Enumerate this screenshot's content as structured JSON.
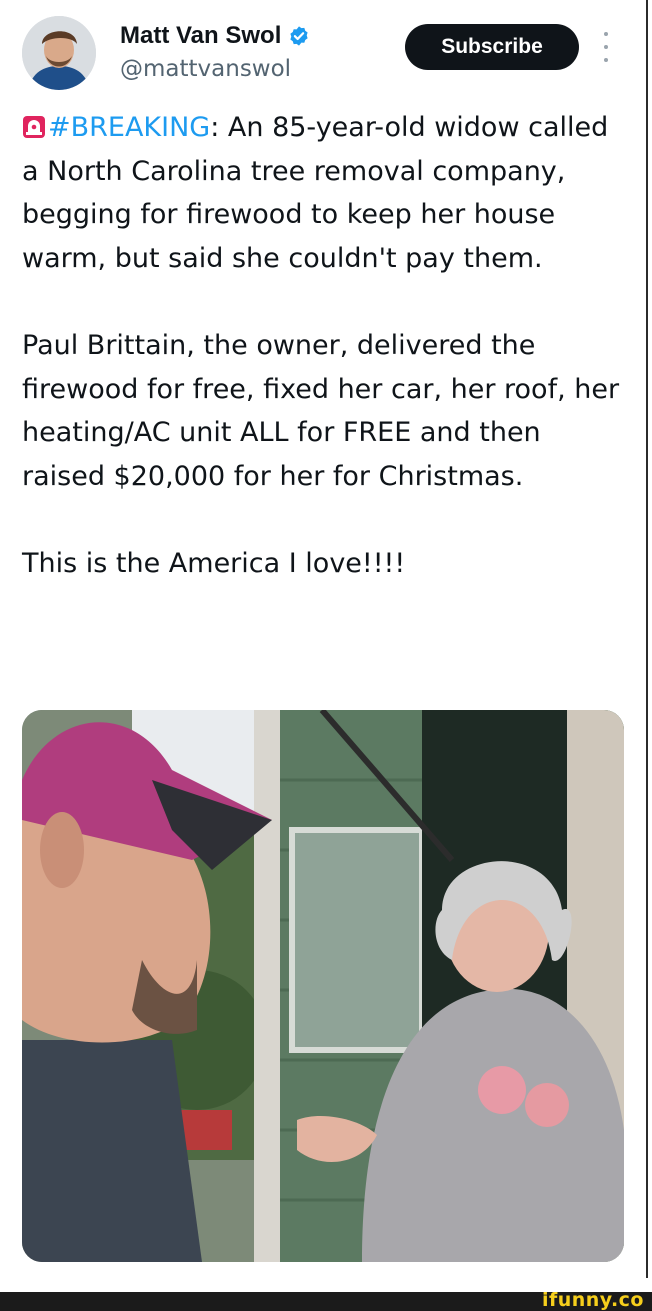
{
  "author": {
    "name": "Matt Van Swol",
    "handle": "@mattvanswol",
    "verified": true,
    "avatar_icon": "profile-photo"
  },
  "actions": {
    "subscribe_label": "Subscribe",
    "more_icon": "more-vertical-icon"
  },
  "tweet": {
    "siren_icon": "police-siren-emoji",
    "hashtag": "#BREAKING",
    "p1_rest": ": An 85-year-old widow called a North Carolina tree removal company, begging for firewood to keep her house warm, but said she couldn't pay them.",
    "p2": "Paul Brittain, the owner, delivered the firewood for free, fixed her car, her roof, her heating/AC unit ALL for FREE and then raised $20,000 for her for Christmas.",
    "p3": "This is the America I love!!!!"
  },
  "media": {
    "type": "video-still",
    "subject_icons": [
      "man-in-cap",
      "elderly-woman-in-doorway"
    ]
  },
  "footer": {
    "watermark": "ifunny.co"
  },
  "colors": {
    "hashtag": "#1d9bf0",
    "verified": "#1d9bf0",
    "subscribe_bg": "#0f1419",
    "watermark": "#f6cf1c"
  }
}
